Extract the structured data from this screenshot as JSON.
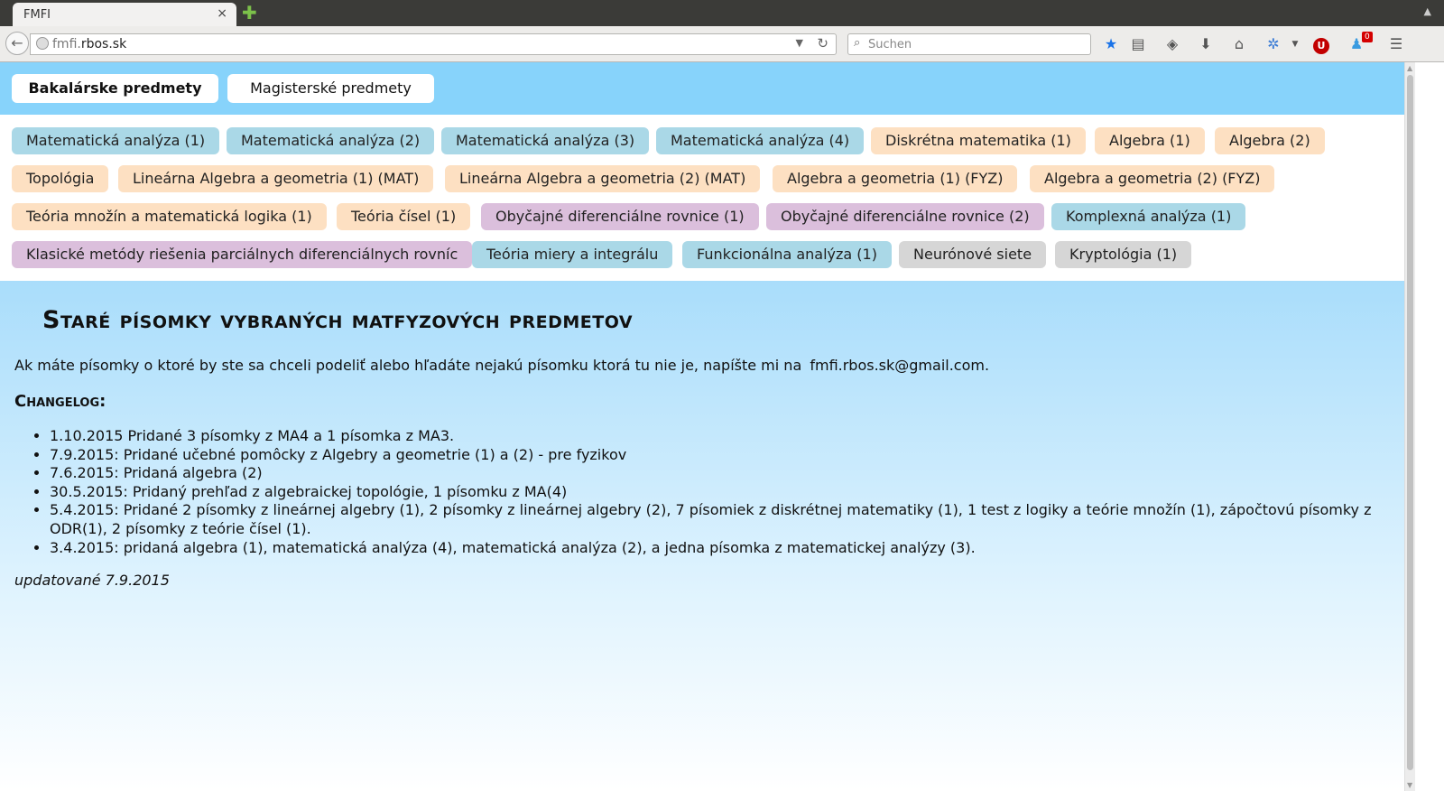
{
  "browser": {
    "tab_title": "FMFI",
    "tab_close": "×",
    "new_tab": "✚",
    "url_host_prefix": "fmfi.",
    "url_host_main": "rbos.sk",
    "search_placeholder": "Suchen",
    "notification_count": "0",
    "ublock_label": "U"
  },
  "topnav": {
    "bachelor_label": "Bakalárske predmety",
    "master_label": "Magisterské predmety"
  },
  "courses": [
    {
      "label": "Matematická analýza (1)",
      "color": "blue"
    },
    {
      "label": "Matematická analýza (2)",
      "color": "blue"
    },
    {
      "label": "Matematická analýza (3)",
      "color": "blue"
    },
    {
      "label": "Matematická analýza (4)",
      "color": "blue"
    },
    {
      "label": "Diskrétna matematika (1)",
      "color": "orange"
    },
    {
      "label": "Algebra (1)",
      "color": "orange"
    },
    {
      "label": "Algebra (2)",
      "color": "orange"
    },
    {
      "label": "Topológia",
      "color": "orange"
    },
    {
      "label": "Lineárna Algebra a geometria (1) (MAT)",
      "color": "orange"
    },
    {
      "label": "Lineárna Algebra a geometria (2) (MAT)",
      "color": "orange"
    },
    {
      "label": "Algebra a geometria (1) (FYZ)",
      "color": "orange"
    },
    {
      "label": "Algebra a geometria (2) (FYZ)",
      "color": "orange"
    },
    {
      "label": "Teória množín a matematická logika (1)",
      "color": "orange"
    },
    {
      "label": "Teória čísel (1)",
      "color": "orange"
    },
    {
      "label": "Obyčajné diferenciálne rovnice (1)",
      "color": "purple"
    },
    {
      "label": "Obyčajné diferenciálne rovnice (2)",
      "color": "purple"
    },
    {
      "label": "Komplexná analýza (1)",
      "color": "blue"
    },
    {
      "label": "Klasické metódy riešenia parciálnych diferenciálnych rovníc",
      "color": "purple"
    },
    {
      "label": "Teória miery a integrálu",
      "color": "blue"
    },
    {
      "label": "Funkcionálna analýza (1)",
      "color": "blue"
    },
    {
      "label": "Neurónové siete",
      "color": "gray"
    },
    {
      "label": "Kryptológia (1)",
      "color": "gray"
    }
  ],
  "colors": {
    "blue": "#aad8e7",
    "orange": "#fde0c2",
    "purple": "#dbbfdc",
    "gray": "#d6d6d6",
    "topnav_bg": "#87d3fb"
  },
  "main": {
    "title": "Staré písomky vybraných matfyzových predmetov",
    "intro_text": "Ak máte písomky o ktoré by ste sa chceli podeliť alebo hľadáte nejakú písomku ktorá tu nie je, napíšte mi na",
    "email": "fmfi.rbos.sk@gmail.com",
    "intro_end": ".",
    "changelog_heading": "Changelog:",
    "changelog": [
      "1.10.2015 Pridané 3 písomky z MA4 a 1 písomka z MA3.",
      "7.9.2015: Pridané učebné pomôcky z Algebry a geometrie (1) a (2) - pre fyzikov",
      "7.6.2015: Pridaná algebra (2)",
      "30.5.2015: Pridaný prehľad z algebraickej topológie, 1 písomku z MA(4)",
      "5.4.2015: Pridané 2 písomky z lineárnej algebry (1), 2 písomky z lineárnej algebry (2), 7 písomiek z diskrétnej matematiky (1), 1 test z logiky a teórie množín (1), zápočtovú písomky z ODR(1), 2 písomky z teórie čísel (1).",
      "3.4.2015: pridaná algebra (1), matematická analýza (4), matematická analýza (2), a jedna písomka z matematickej analýzy (3)."
    ],
    "updated": "updatované 7.9.2015"
  }
}
